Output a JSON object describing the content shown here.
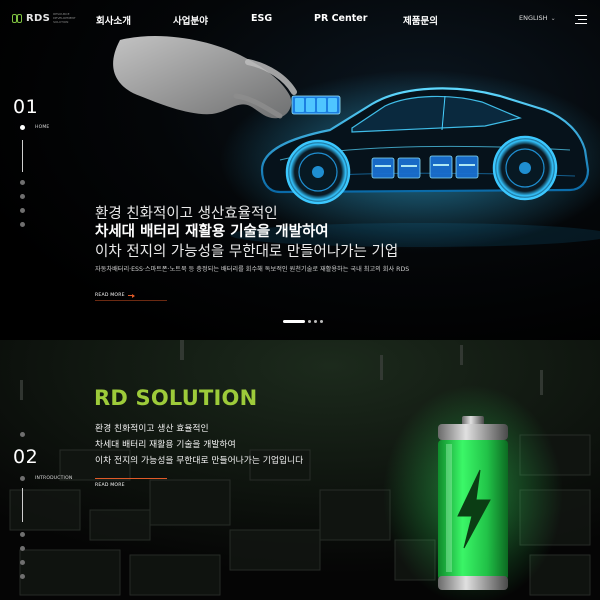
{
  "header": {
    "logo_text": "RDS",
    "logo_tagline": "RESOURCE DEVELOPMENT SOLUTION",
    "nav": [
      "회사소개",
      "사업분야",
      "ESG",
      "PR Center",
      "제품문의"
    ],
    "language": "ENGLISH",
    "menu_icon": "hamburger-icon"
  },
  "hero": {
    "number": "01",
    "side_label": "HOME",
    "line1": "환경 친화적이고 생산효율적인",
    "line2": "차세대 배터리 재활용 기술을 개발하여",
    "line3": "이차 전지의 가능성을 무한대로 만들어나가는 기업",
    "description": "자동차배터리·ESS·스마트폰·노트북 등 충정되는 배터리를 회수해 독보적인 원천기술로 재활용하는 국내 최고의 회사 RDS",
    "read_more": "READ MORE",
    "slide_count": 4,
    "active_slide": 1
  },
  "intro": {
    "number": "02",
    "side_label": "INTRODUCTION",
    "title": "RD SOLUTION",
    "lines": [
      "환경 친화적이고 생산 효율적인",
      "차세대 배터리 재활용 기술을 개발하여",
      "이차 전지의 가능성을 무한대로 만들어나가는 기업입니다"
    ],
    "read_more": "READ MORE"
  },
  "colors": {
    "accent_green": "#9dcb3a",
    "accent_orange": "#e05a28",
    "car_glow": "#2fb6ff",
    "battery_glow": "#39ff6a"
  },
  "icons": [
    "logo-mark-icon",
    "chevron-down-icon",
    "hamburger-icon",
    "arrow-right-icon",
    "lightning-icon"
  ]
}
